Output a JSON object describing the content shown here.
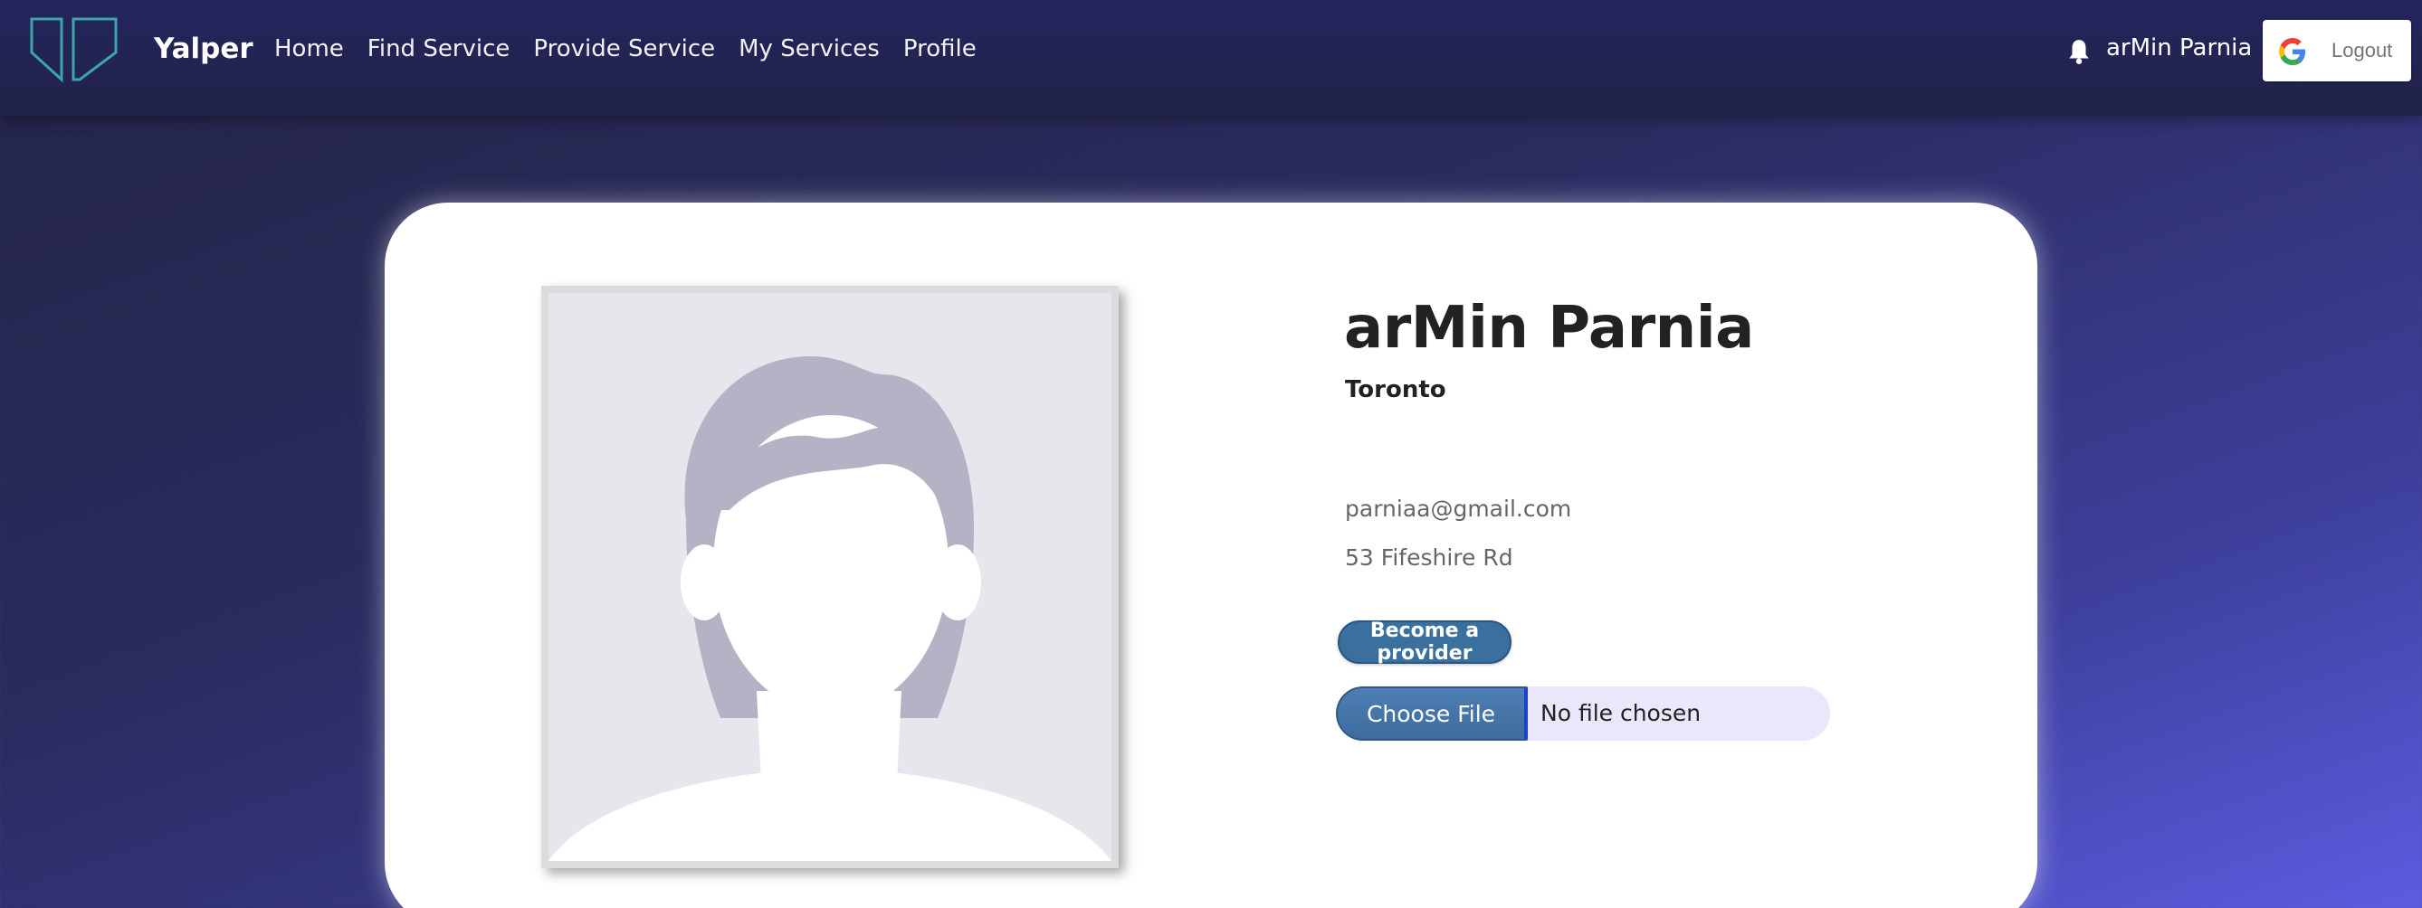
{
  "nav": {
    "brand": "Yalper",
    "links": [
      {
        "label": "Home"
      },
      {
        "label": "Find Service"
      },
      {
        "label": "Provide Service"
      },
      {
        "label": "My Services"
      },
      {
        "label": "Profile"
      }
    ],
    "user_name": "arMin Parnia",
    "logout_label": "Logout",
    "icons": {
      "logo": "yalper-logo",
      "notifications": "bell-icon",
      "google": "google-icon"
    }
  },
  "profile": {
    "name": "arMin Parnia",
    "city": "Toronto",
    "email": "parniaa@gmail.com",
    "address": "53 Fifeshire Rd",
    "become_provider_label": "Become a provider",
    "file_input": {
      "button_label": "Choose File",
      "status": "No file chosen"
    },
    "avatar": "default-avatar-placeholder"
  },
  "colors": {
    "nav_bg": "#222348",
    "accent": "#3a6f9e",
    "background_end": "#5c5ce0",
    "card_bg": "#ffffff"
  }
}
